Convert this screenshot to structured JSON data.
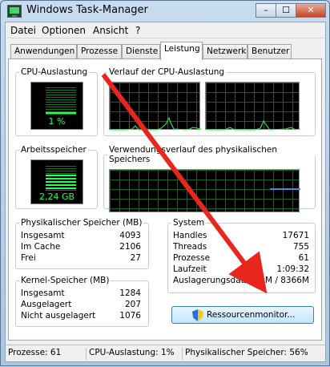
{
  "window": {
    "title": "Windows Task-Manager",
    "minimize": "–",
    "maximize": "☐",
    "close": "✕"
  },
  "menu": {
    "items": [
      "Datei",
      "Optionen",
      "Ansicht",
      "?"
    ]
  },
  "tabs": [
    "Anwendungen",
    "Prozesse",
    "Dienste",
    "Leistung",
    "Netzwerk",
    "Benutzer"
  ],
  "active_tab": "Leistung",
  "cpu": {
    "label": "CPU-Auslastung",
    "value": "1 %",
    "level": 0.01,
    "history_label": "Verlauf der CPU-Auslastung"
  },
  "memory": {
    "label": "Arbeitsspeicher",
    "value": "2,24 GB",
    "level": 0.56,
    "history_label": "Verwendungsverlauf des physikalischen Speichers"
  },
  "physical": {
    "label": "Physikalischer Speicher (MB)",
    "rows": [
      {
        "k": "Insgesamt",
        "v": "4093"
      },
      {
        "k": "Im Cache",
        "v": "2106"
      },
      {
        "k": "Frei",
        "v": "27"
      }
    ]
  },
  "kernel": {
    "label": "Kernel-Speicher (MB)",
    "rows": [
      {
        "k": "Insgesamt",
        "v": "1284"
      },
      {
        "k": "Ausgelagert",
        "v": "207"
      },
      {
        "k": "Nicht ausgelagert",
        "v": "1076"
      }
    ]
  },
  "system": {
    "label": "System",
    "rows": [
      {
        "k": "Handles",
        "v": "17671"
      },
      {
        "k": "Threads",
        "v": "755"
      },
      {
        "k": "Prozesse",
        "v": "61"
      },
      {
        "k": "Laufzeit",
        "v": "1:09:32"
      },
      {
        "k": "Auslagerungsdatei",
        "v": "2515M / 8366M"
      }
    ]
  },
  "resource_button": "Ressourcenmonitor...",
  "status": {
    "processes": "Prozesse: 61",
    "cpu": "CPU-Auslastung: 1%",
    "memory": "Physikalischer Speicher: 56%"
  },
  "colors": {
    "graph_line": "#2aff55",
    "grid": "#0b6a1e",
    "memory_line": "#3f8fd9",
    "annotation_arrow": "#e8261d"
  }
}
